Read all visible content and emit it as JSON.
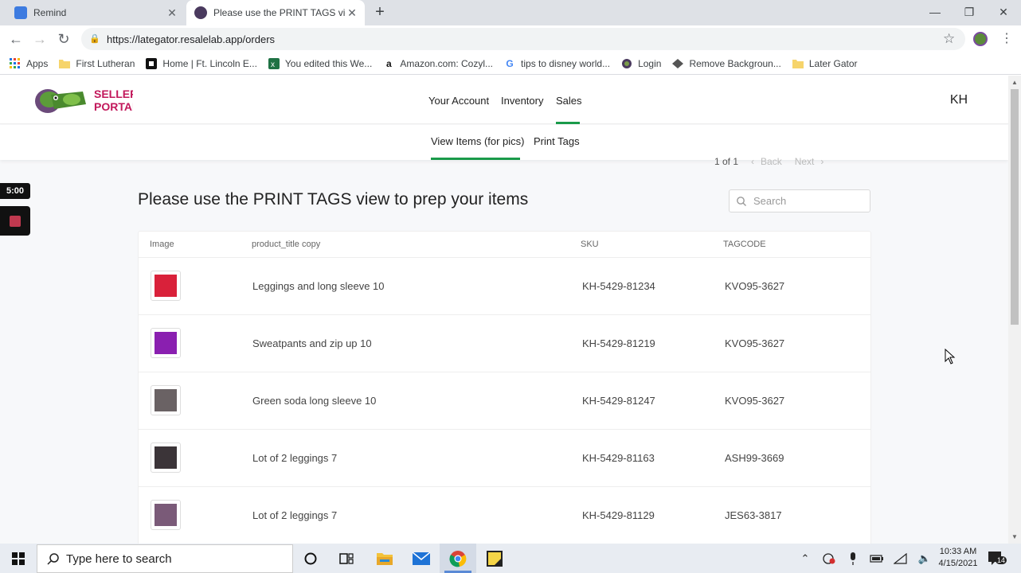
{
  "browser": {
    "tabs": [
      {
        "title": "Remind"
      },
      {
        "title": "Please use the PRINT TAGS view to prep your items"
      }
    ],
    "url": "https://lategator.resalelab.app/orders",
    "bookmarks": [
      {
        "label": "Apps",
        "icon": "apps-grid-icon"
      },
      {
        "label": "First Lutheran",
        "icon": "folder-icon"
      },
      {
        "label": "Home | Ft. Lincoln E...",
        "icon": "site-icon"
      },
      {
        "label": "You edited this We...",
        "icon": "excel-icon"
      },
      {
        "label": "Amazon.com: Cozyl...",
        "icon": "amazon-icon"
      },
      {
        "label": "tips to disney world...",
        "icon": "google-icon"
      },
      {
        "label": "Login",
        "icon": "login-icon"
      },
      {
        "label": "Remove Backgroun...",
        "icon": "remove-bg-icon"
      },
      {
        "label": "Later Gator",
        "icon": "folder-icon"
      }
    ]
  },
  "site": {
    "logo_text": "SELLER PORTAL",
    "nav": [
      "Your Account",
      "Inventory",
      "Sales"
    ],
    "active_nav": "Sales",
    "avatar": "KH",
    "subnav": [
      "View Items (for pics)",
      "Print Tags"
    ],
    "active_subnav": "View Items (for pics)"
  },
  "pager": {
    "count": "1 of 1",
    "back": "Back",
    "next": "Next"
  },
  "heading": "Please use the PRINT TAGS view to prep your items",
  "search": {
    "placeholder": "Search",
    "value": ""
  },
  "table": {
    "columns": [
      "Image",
      "product_title copy",
      "SKU",
      "TAGCODE"
    ],
    "rows": [
      {
        "title": "Leggings and long sleeve 10",
        "sku": "KH-5429-81234",
        "tagcode": "KVO95-3627",
        "thumb_color": "#d9213a"
      },
      {
        "title": "Sweatpants and zip up 10",
        "sku": "KH-5429-81219",
        "tagcode": "KVO95-3627",
        "thumb_color": "#8a1fb0"
      },
      {
        "title": "Green soda long sleeve 10",
        "sku": "KH-5429-81247",
        "tagcode": "KVO95-3627",
        "thumb_color": "#6a6264"
      },
      {
        "title": "Lot of 2 leggings 7",
        "sku": "KH-5429-81163",
        "tagcode": "ASH99-3669",
        "thumb_color": "#3b3438"
      },
      {
        "title": "Lot of 2 leggings 7",
        "sku": "KH-5429-81129",
        "tagcode": "JES63-3817",
        "thumb_color": "#7a5a78"
      }
    ]
  },
  "overlay": {
    "timer": "5:00"
  },
  "taskbar": {
    "search_placeholder": "Type here to search",
    "time": "10:33 AM",
    "date": "4/15/2021",
    "notifications": "14"
  },
  "colors": {
    "accent": "#1a9a4a",
    "brand_pink": "#c2185b"
  }
}
